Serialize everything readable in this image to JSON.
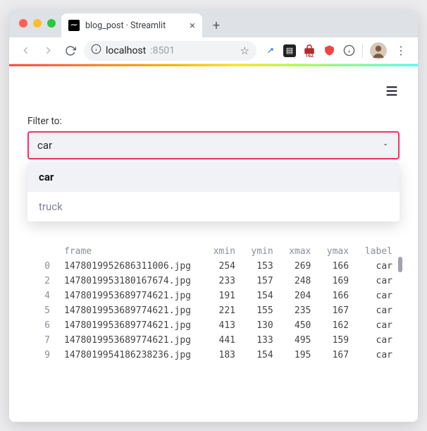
{
  "browser": {
    "tab_title": "blog_post · Streamlit",
    "url_host": "localhost",
    "url_port": ":8501",
    "ext_badge": "162"
  },
  "app": {
    "filter_label": "Filter to:",
    "select_value": "car",
    "options": {
      "0": "car",
      "1": "truck"
    }
  },
  "table": {
    "headers": {
      "frame": "frame",
      "xmin": "xmin",
      "ymin": "ymin",
      "xmax": "xmax",
      "ymax": "ymax",
      "label": "label"
    },
    "rows": {
      "0": {
        "idx": "0",
        "frame": "1478019952686311006.jpg",
        "xmin": "254",
        "ymin": "153",
        "xmax": "269",
        "ymax": "166",
        "label": "car"
      },
      "1": {
        "idx": "2",
        "frame": "1478019953180167674.jpg",
        "xmin": "233",
        "ymin": "157",
        "xmax": "248",
        "ymax": "169",
        "label": "car"
      },
      "2": {
        "idx": "4",
        "frame": "1478019953689774621.jpg",
        "xmin": "191",
        "ymin": "154",
        "xmax": "204",
        "ymax": "166",
        "label": "car"
      },
      "3": {
        "idx": "5",
        "frame": "1478019953689774621.jpg",
        "xmin": "221",
        "ymin": "155",
        "xmax": "235",
        "ymax": "167",
        "label": "car"
      },
      "4": {
        "idx": "6",
        "frame": "1478019953689774621.jpg",
        "xmin": "413",
        "ymin": "130",
        "xmax": "450",
        "ymax": "162",
        "label": "car"
      },
      "5": {
        "idx": "7",
        "frame": "1478019953689774621.jpg",
        "xmin": "441",
        "ymin": "133",
        "xmax": "495",
        "ymax": "159",
        "label": "car"
      },
      "6": {
        "idx": "9",
        "frame": "1478019954186238236.jpg",
        "xmin": "183",
        "ymin": "154",
        "xmax": "195",
        "ymax": "167",
        "label": "car"
      }
    }
  }
}
